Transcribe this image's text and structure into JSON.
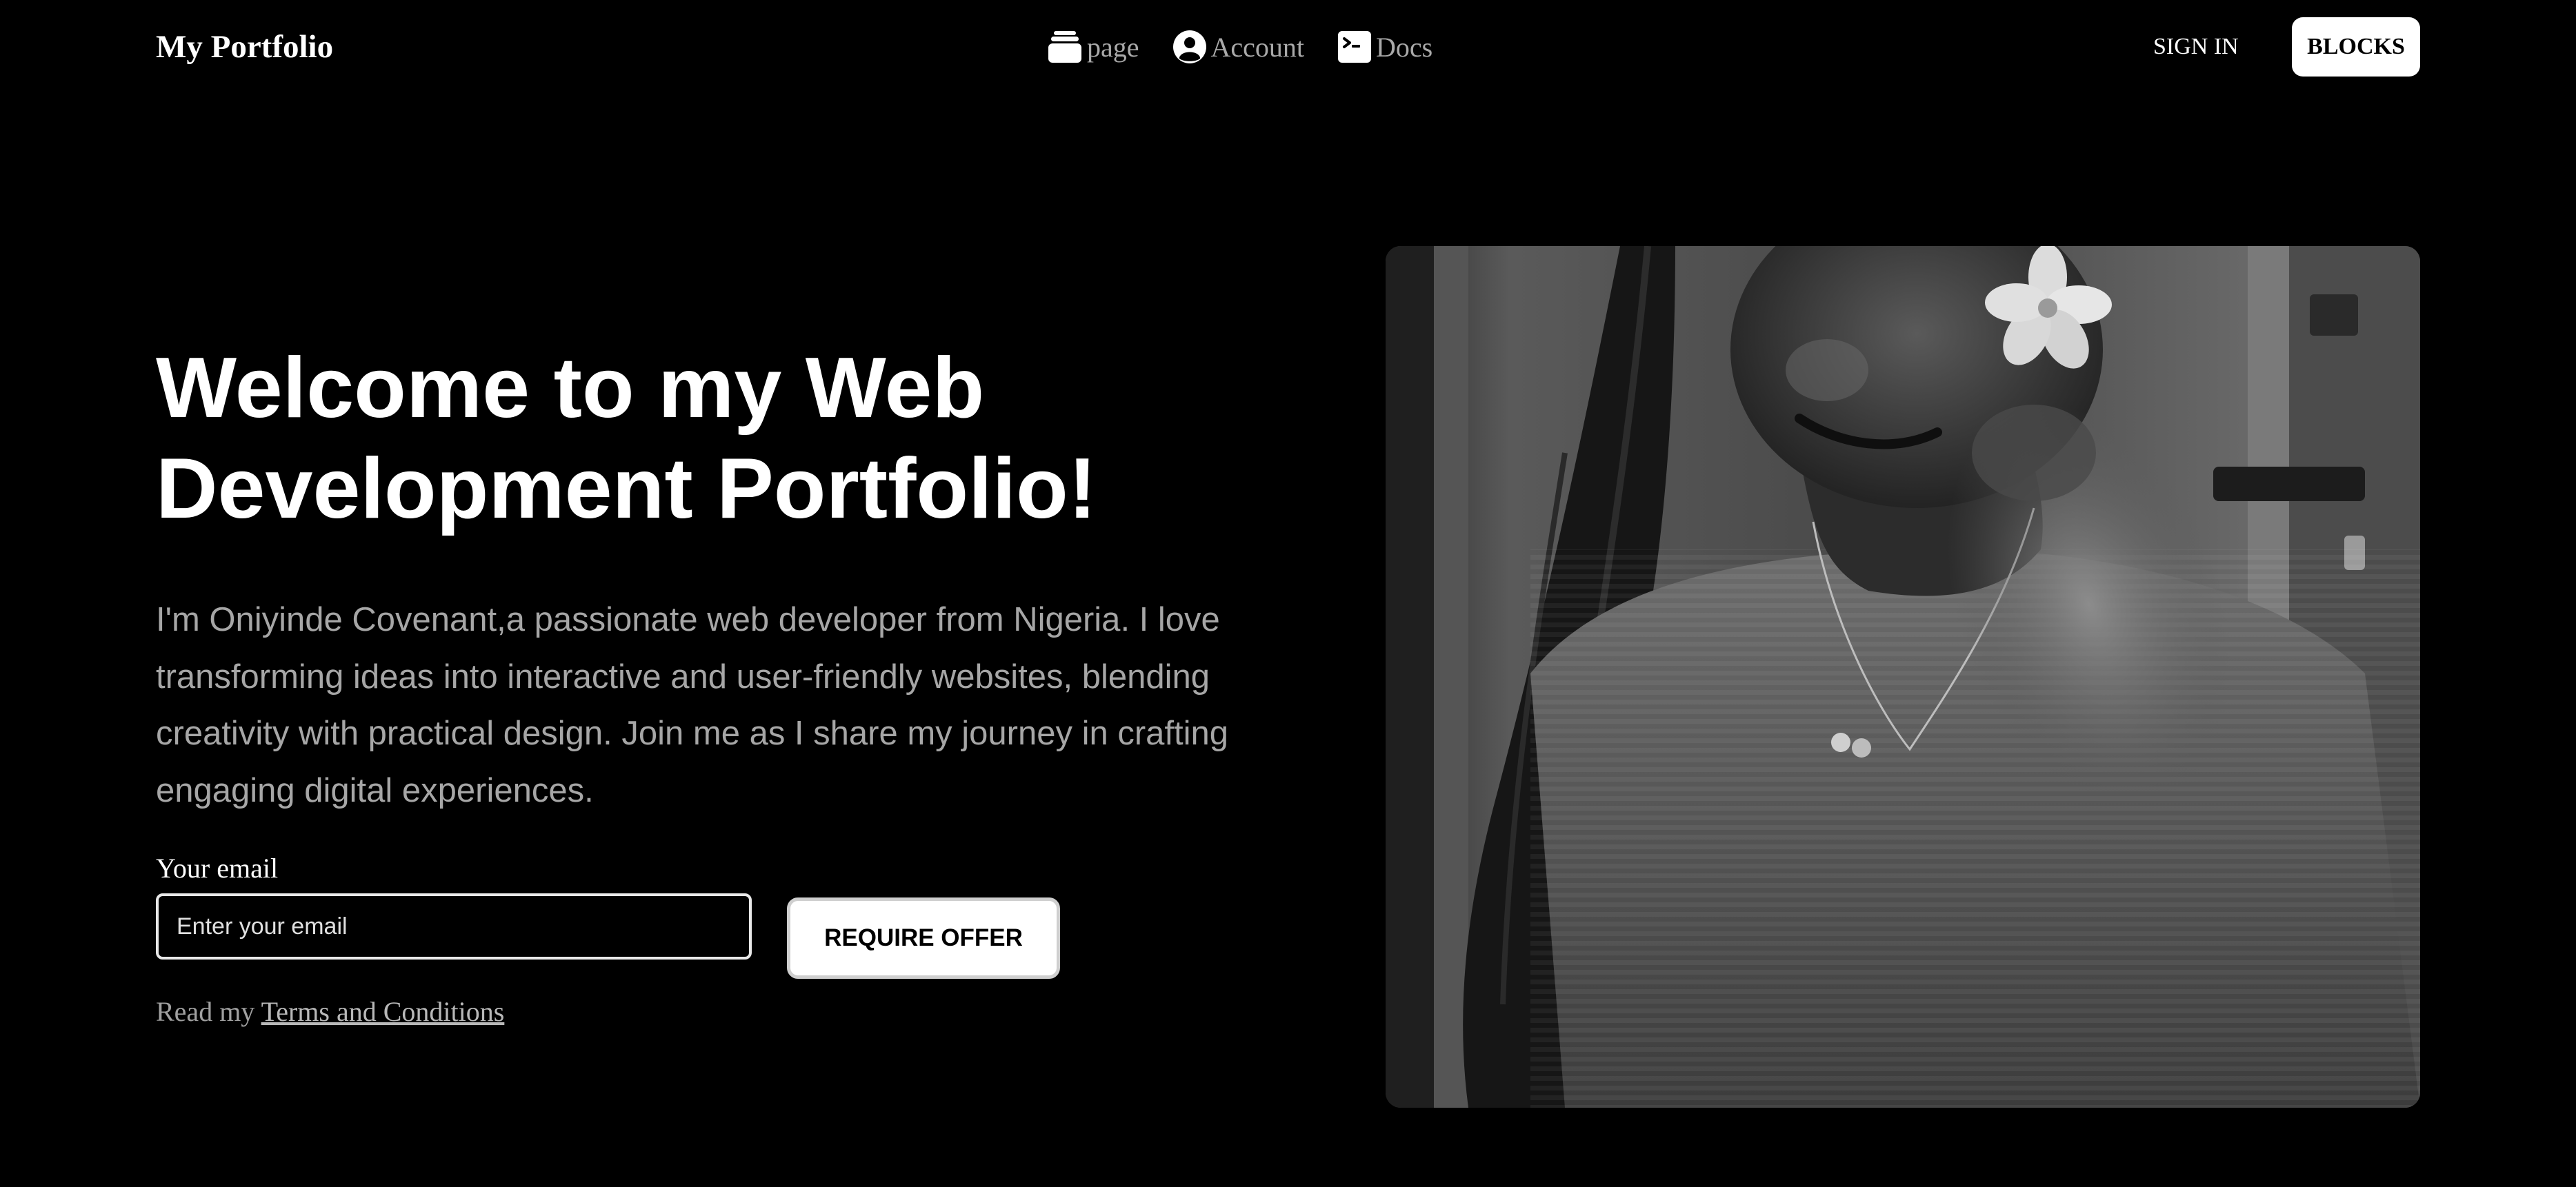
{
  "nav": {
    "brand": "My Portfolio",
    "links": [
      {
        "label": "page",
        "icon": "layers-icon"
      },
      {
        "label": "Account",
        "icon": "user-circle-icon"
      },
      {
        "label": "Docs",
        "icon": "terminal-icon"
      }
    ],
    "sign_in": "SIGN IN",
    "blocks": "BLOCKS"
  },
  "hero": {
    "title": "Welcome to my Web Development Portfolio!",
    "description": "I'm Oniyinde Covenant,a passionate web developer from Nigeria. I love transforming ideas into interactive and user-friendly websites, blending creativity with practical design. Join me as I share my journey in crafting engaging digital experiences.",
    "email_label": "Your email",
    "email_placeholder": "Enter your email",
    "email_value": "",
    "cta": "REQUIRE OFFER",
    "terms_prefix": "Read my",
    "terms_link": "Terms and Conditions"
  },
  "photo": {
    "style": "black-and-white portrait"
  },
  "colors": {
    "background": "#000000",
    "text": "#ffffff",
    "muted": "#a6a6a6",
    "button_bg": "#ffffff"
  }
}
